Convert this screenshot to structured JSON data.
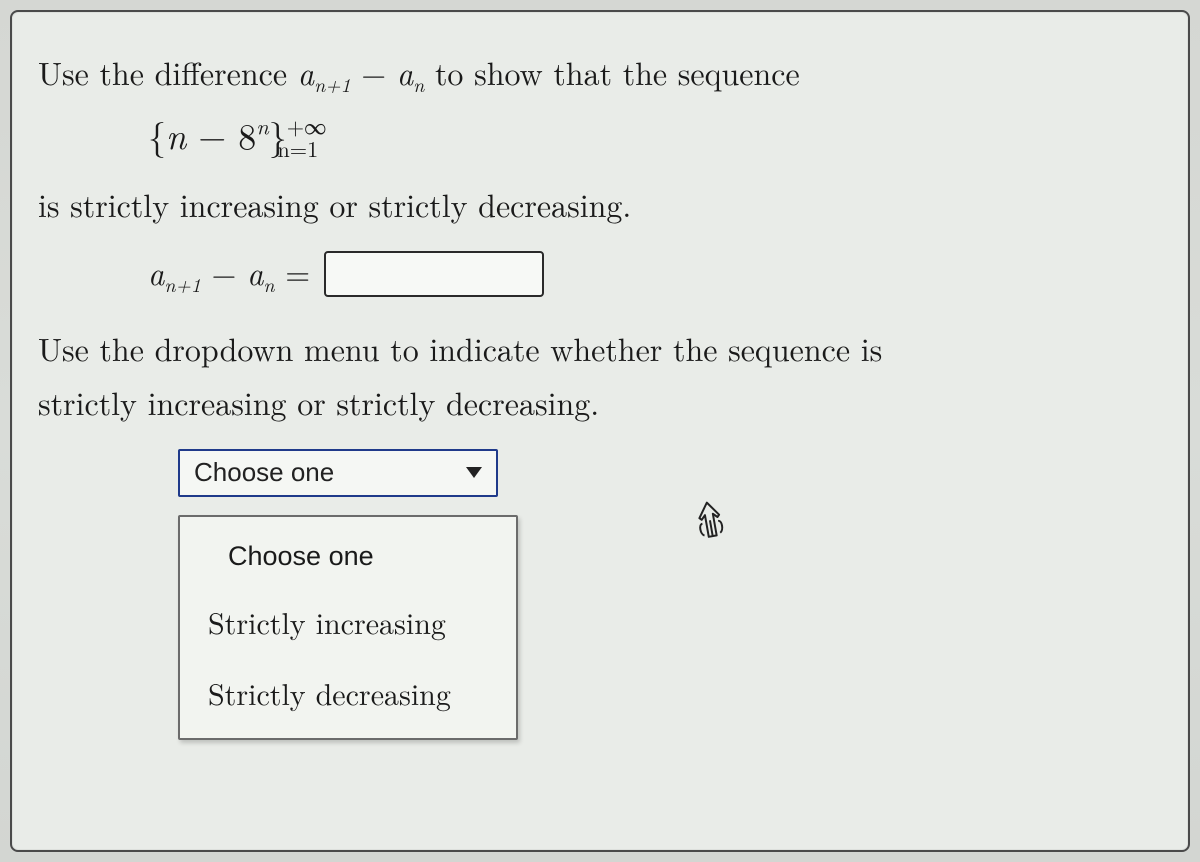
{
  "question": {
    "line1_prefix": "Use the difference ",
    "diff_expr_a": "a",
    "diff_expr_sub1": "n+1",
    "diff_expr_minus": " − ",
    "diff_expr_b": "a",
    "diff_expr_sub2": "n",
    "line1_suffix": " to show that the sequence",
    "sequence_open": "{",
    "sequence_var": "n",
    "sequence_minus": " − 8",
    "sequence_exp": "n",
    "sequence_close": "}",
    "sequence_upper": "+∞",
    "sequence_lower": "n=1",
    "line2": "is strictly increasing or strictly decreasing.",
    "answer_label_a": "a",
    "answer_label_sub1": "n+1",
    "answer_label_minus": " − ",
    "answer_label_b": "a",
    "answer_label_sub2": "n",
    "answer_label_eq": " =",
    "answer_value": "",
    "line3": "Use the dropdown menu to indicate whether the sequence is",
    "line4": "strictly increasing or strictly decreasing."
  },
  "dropdown": {
    "selected": "Choose one",
    "options": {
      "placeholder": "Choose one",
      "opt1": "Strictly increasing",
      "opt2": "Strictly decreasing"
    }
  }
}
